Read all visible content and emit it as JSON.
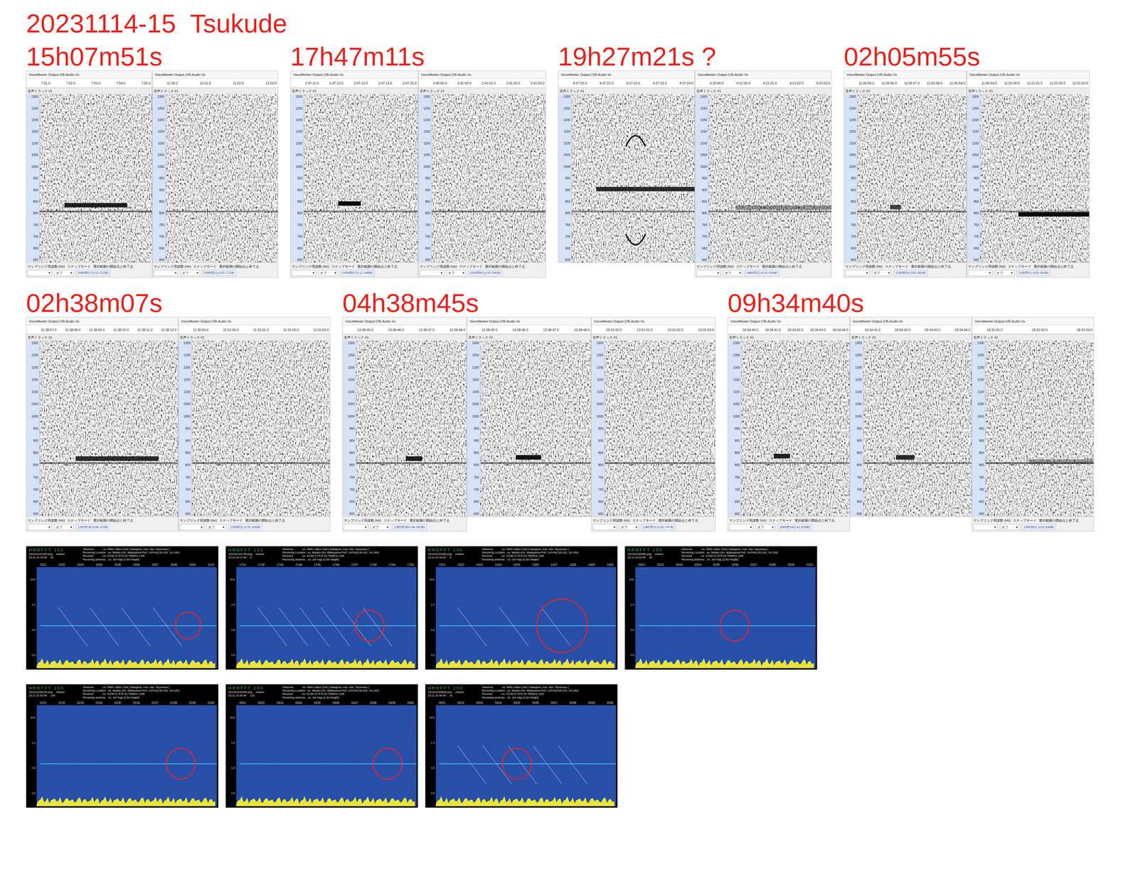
{
  "title": "20231114-15  Tsukude",
  "device_label": "VoiceMeeter Output (VB-Audio Vo",
  "track_label": "音声トラック #1",
  "freq_ticks": [
    "1300",
    "1250",
    "1200",
    "1150",
    "1100",
    "1050",
    "1000",
    "950",
    "900",
    "850",
    "800",
    "750",
    "700",
    "650",
    "600"
  ],
  "footer_labels": [
    "サンプリング周波数 (Hz)",
    "スナップモード",
    "選択範囲の開始点と終了点"
  ],
  "snap_value": "オフ",
  "dropdown_glyph": "▾",
  "rows": [
    {
      "events": [
        {
          "label": "15h07m51s",
          "panels": [
            {
              "ticks": [
                "7:51.0",
                "7:52.0",
                "7:53.0",
                "7:54.0",
                "7:55.0"
              ],
              "readout": "00時間07分52.015秒",
              "carrier": 0.55,
              "echoes": [
                {
                  "kind": "bar",
                  "start": 0.22,
                  "end": 0.78,
                  "freq": 838,
                  "strength": 0.9
                }
              ]
            },
            {
              "ticks": [
                "11:00.0",
                "11:01.0",
                "11:02.0",
                "11:03.0"
              ],
              "readout": "00時間11分00.712秒",
              "carrier": 0.45,
              "echoes": []
            }
          ]
        },
        {
          "label": "17h47m11s",
          "panels": [
            {
              "ticks": [
                "2:47:11.0",
                "2:47:12.0",
                "2:47:13.0",
                "2:47:14.0",
                "2:47:15.0"
              ],
              "readout": "02時間47分12.448秒",
              "carrier": 0.45,
              "echoes": [
                {
                  "kind": "bar",
                  "start": 0.3,
                  "end": 0.5,
                  "freq": 845,
                  "strength": 1
                }
              ]
            },
            {
              "ticks": [
                "2:40:59.0",
                "2:41:00.0",
                "2:41:01.0",
                "2:41:02.0",
                "2:41:03.0"
              ],
              "readout": "02時間41分00.546秒",
              "carrier": 0.5,
              "echoes": []
            }
          ]
        },
        {
          "label": "19h27m21s ?",
          "panels": [
            {
              "ticks": [
                "4:27:20.0",
                "4:27:21.0",
                "4:27:22.0",
                "4:27:23.0",
                "4:27:24.0"
              ],
              "readout": "",
              "carrier": 0.45,
              "echoes": [
                {
                  "kind": "bar",
                  "start": 0.2,
                  "end": 1,
                  "freq": 905,
                  "strength": 0.85
                },
                {
                  "kind": "arc-up",
                  "start": 0.44,
                  "end": 0.6,
                  "freq": 1110,
                  "strength": 0.9
                },
                {
                  "kind": "arc-down",
                  "start": 0.44,
                  "end": 0.6,
                  "freq": 690,
                  "strength": 0.9
                }
              ]
            },
            {
              "ticks": [
                "4:20:59.0",
                "4:21:00.0",
                "4:21:01.0",
                "4:21:02.0",
                "4:21:03.0"
              ],
              "readout": "04時間21分00.559秒",
              "carrier": 0.45,
              "echoes": [
                {
                  "kind": "bar",
                  "start": 0.22,
                  "end": 1,
                  "freq": 828,
                  "strength": 0.4
                }
              ]
            }
          ]
        },
        {
          "label": "02h05m55s",
          "panels": [
            {
              "ticks": [
                "11:05:55.0",
                "11:05:56.0",
                "11:05:57.0",
                "11:05:58.0",
                "11:05:59.0"
              ],
              "readout": "11時間05分55.865秒",
              "carrier": 0.5,
              "echoes": [
                {
                  "kind": "bar",
                  "start": 0.3,
                  "end": 0.4,
                  "freq": 830,
                  "strength": 0.75
                }
              ]
            },
            {
              "ticks": [
                "11:00:59.0",
                "11:01:00.0",
                "11:01:01.0",
                "11:01:02.0",
                "11:01:03.0"
              ],
              "readout": "11時間01分00.669秒",
              "carrier": 0.4,
              "echoes": [
                {
                  "kind": "bar",
                  "start": 0.35,
                  "end": 1,
                  "freq": 800,
                  "strength": 1
                }
              ]
            }
          ]
        }
      ]
    },
    {
      "events": [
        {
          "label": "02h38m07s",
          "panels": [
            {
              "ticks": [
                "11:38:07.0",
                "11:38:08.0",
                "11:38:09.0",
                "11:38:10.0",
                "11:38:11.0",
                "11:38:12.0"
              ],
              "readout": "11時間38分08.020秒",
              "carrier": 0.5,
              "echoes": [
                {
                  "kind": "bar",
                  "start": 0.26,
                  "end": 0.86,
                  "freq": 830,
                  "strength": 0.85
                }
              ]
            },
            {
              "ticks": [
                "11:30:59.0",
                "11:31:00.0",
                "11:31:01.0",
                "11:31:02.0",
                "11:31:03.0"
              ],
              "readout": "11時間31分00.936秒",
              "carrier": 0.5,
              "echoes": []
            }
          ]
        },
        {
          "label": "04h38m45s",
          "panels": [
            {
              "ticks": [
                "13:38:45.0",
                "13:38:46.0",
                "13:38:47.0",
                "13:38:48.0"
              ],
              "readout": "13時間38分46.063秒",
              "carrier": 0.5,
              "echoes": [
                {
                  "kind": "bar",
                  "start": 0.45,
                  "end": 0.6,
                  "freq": 830,
                  "strength": 0.9
                }
              ]
            },
            {
              "ticks": [
                "13:38:45.0",
                "13:38:46.0",
                "13:38:47.0",
                "13:38:48.0"
              ],
              "readout": "",
              "carrier": 0.5,
              "echoes": [
                {
                  "kind": "bar",
                  "start": 0.32,
                  "end": 0.55,
                  "freq": 835,
                  "strength": 0.95
                }
              ]
            },
            {
              "ticks": [
                "13:31:00.0",
                "13:31:01.0",
                "13:31:02.0",
                "13:31:03.0"
              ],
              "readout": "13時間31分00.747秒",
              "carrier": 0.5,
              "echoes": []
            }
          ]
        },
        {
          "label": "09h34m40s",
          "panels": [
            {
              "ticks": [
                "18:34:40.0",
                "18:34:41.0",
                "18:34:42.0",
                "18:34:43.0",
                "18:34:44.0"
              ],
              "readout": "18時間34分41.828秒",
              "carrier": 0.45,
              "echoes": [
                {
                  "kind": "bar",
                  "start": 0.3,
                  "end": 0.45,
                  "freq": 840,
                  "strength": 0.9
                }
              ]
            },
            {
              "ticks": [
                "18:34:41.0",
                "18:34:42.0",
                "18:34:43.0",
                "18:34:44.0"
              ],
              "readout": "",
              "carrier": 0.45,
              "echoes": [
                {
                  "kind": "bar",
                  "start": 0.3,
                  "end": 0.47,
                  "freq": 835,
                  "strength": 0.85
                }
              ]
            },
            {
              "ticks": [
                "18:31:01.0",
                "18:31:02.0",
                "18:31:03.0"
              ],
              "readout": "18時間31分00.849秒",
              "carrier": 0.55,
              "echoes": [
                {
                  "kind": "bar",
                  "start": 0.4,
                  "end": 1,
                  "freq": 818,
                  "strength": 0.35
                }
              ]
            }
          ]
        }
      ]
    }
  ],
  "hrofft_header": {
    "logo": "HROFFT 100",
    "meteor_label": "meteor",
    "info": [
      "Observer          : ex. RMG Video Club [ Nakajima, Arai, Abe, Toyomasu ]",
      "Receiving Location : ex. Misato-cho, Wakayama-Pref, JAPAN(135.41E, 34.14N)",
      "Receiver          : ex. ICOM IC-R75 53.750MHz USB",
      "Receiving antenna  : ex. 2el-Yagi (2.5m height)"
    ],
    "axis": [
      "kHz",
      "1.0",
      "0.8",
      "0.6"
    ]
  },
  "hrofft": [
    {
      "file": "XX2311141500.png",
      "date": "23.11.14 15:00",
      "count": "82",
      "ticks": [
        "1501",
        "1502",
        "1503",
        "1504",
        "1505",
        "1506",
        "1507",
        "1508",
        "1509",
        "1510"
      ],
      "streaks": 4,
      "marker": {
        "x": 0.84,
        "r": 0.07
      }
    },
    {
      "file": "XX2311141740.png",
      "date": "23.11.14 17:40",
      "count": "6",
      "ticks": [
        "1741",
        "1742",
        "1743",
        "1744",
        "1745",
        "1746",
        "1747",
        "1748",
        "1749",
        "1750"
      ],
      "streaks": 6,
      "marker": {
        "x": 0.74,
        "r": 0.08
      }
    },
    {
      "file": "XX2311141920.png",
      "date": "23.11.14 19:20",
      "count": "5",
      "ticks": [
        "1921",
        "1922",
        "1923",
        "1924",
        "1925",
        "1926",
        "1927",
        "1928",
        "1929",
        "1930"
      ],
      "streaks": 3,
      "marker": {
        "x": 0.7,
        "r": 0.14
      }
    },
    {
      "file": "XX2311150200.png",
      "date": "23.11.15 02:00",
      "count": "82",
      "ticks": [
        "0201",
        "0202",
        "0203",
        "0204",
        "0205",
        "0206",
        "0207",
        "0208",
        "0209",
        "0210"
      ],
      "streaks": 0,
      "marker": {
        "x": 0.55,
        "r": 0.08
      }
    },
    {
      "file": "XX2311150230.png",
      "date": "23.11.15 02:30",
      "count": "129",
      "ticks": [
        "0231",
        "0232",
        "0233",
        "0234",
        "0235",
        "0236",
        "0237",
        "0238",
        "0239",
        "0240"
      ],
      "streaks": 0,
      "marker": {
        "x": 0.8,
        "r": 0.08
      }
    },
    {
      "file": "XX2311150430.png",
      "date": "23.11.15 04:30",
      "count": "123",
      "ticks": [
        "0431",
        "0432",
        "0433",
        "0434",
        "0435",
        "0436",
        "0437",
        "0438",
        "0439",
        "0440"
      ],
      "streaks": 0,
      "marker": {
        "x": 0.84,
        "r": 0.08
      }
    },
    {
      "file": "XX2311150930.png",
      "date": "23.11.15 09:30",
      "count": "41",
      "ticks": [
        "0931",
        "0932",
        "0933",
        "0934",
        "0935",
        "0936",
        "0937",
        "0938",
        "0939",
        "0940"
      ],
      "streaks": 5,
      "marker": {
        "x": 0.45,
        "r": 0.08
      }
    }
  ]
}
